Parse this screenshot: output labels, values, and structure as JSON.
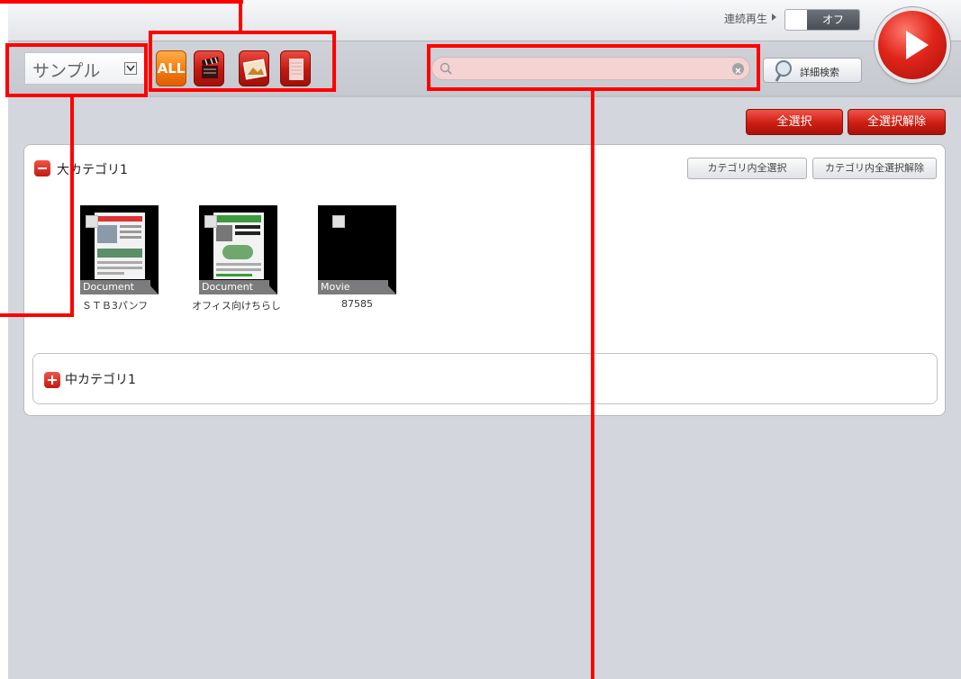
{
  "header": {
    "continuous_play_label": "連続再生",
    "toggle_state": "オフ",
    "category_select_value": "サンプル",
    "type_filters": [
      "ALL",
      "movie",
      "image",
      "document"
    ],
    "search_placeholder": "",
    "advanced_search_label": "詳細検索"
  },
  "actions": {
    "select_all": "全選択",
    "deselect_all": "全選択解除"
  },
  "category": {
    "title": "大カテゴリ1",
    "select_in_category": "カテゴリ内全選択",
    "deselect_in_category": "カテゴリ内全選択解除",
    "items": [
      {
        "type": "Document",
        "caption": "ＳＴＢ3パンフ"
      },
      {
        "type": "Document",
        "caption": "オフィス向けちらし"
      },
      {
        "type": "Movie",
        "caption": "87585"
      }
    ],
    "sub_category_title": "中カテゴリ1"
  },
  "colors": {
    "accent_red": "#cc1d12",
    "all_orange": "#f27b0e",
    "annotation": "#ff0000"
  }
}
